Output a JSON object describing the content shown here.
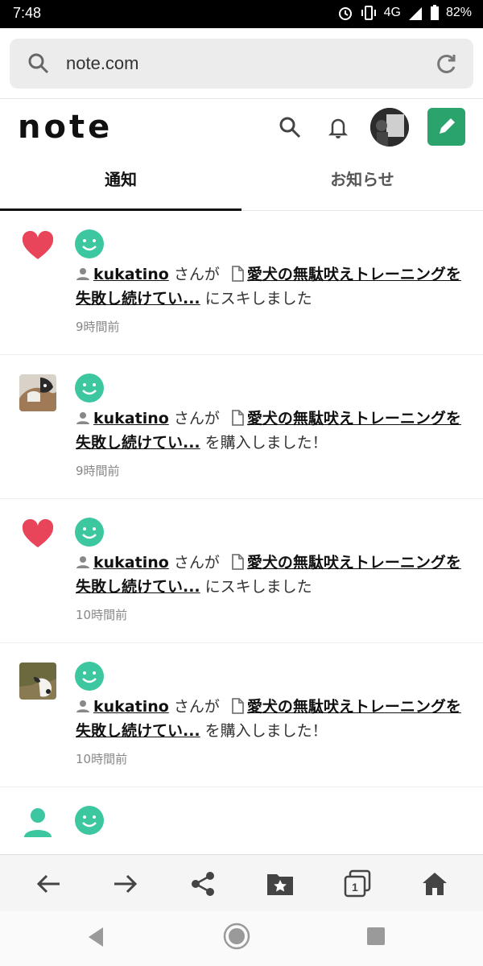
{
  "status": {
    "time": "7:48",
    "network": "4G",
    "battery": "82%"
  },
  "browser": {
    "url": "note.com"
  },
  "header": {
    "logo": "note"
  },
  "tabs": [
    {
      "label": "通知"
    },
    {
      "label": "お知らせ"
    }
  ],
  "notifications": [
    {
      "lead_icon": "heart-icon",
      "username": "kukatino",
      "connector": "さんが",
      "article": "愛犬の無駄吠えトレーニングを失敗し続けてい...",
      "action": "にスキしました",
      "time": "9時間前"
    },
    {
      "lead_icon": "user-thumbnail",
      "username": "kukatino",
      "connector": "さんが",
      "article": "愛犬の無駄吠えトレーニングを失敗し続けてい...",
      "action": "を購入しました！",
      "time": "9時間前"
    },
    {
      "lead_icon": "heart-icon",
      "username": "kukatino",
      "connector": "さんが",
      "article": "愛犬の無駄吠えトレーニングを失敗し続けてい...",
      "action": "にスキしました",
      "time": "10時間前"
    },
    {
      "lead_icon": "user-thumbnail",
      "username": "kukatino",
      "connector": "さんが",
      "article": "愛犬の無駄吠えトレーニングを失敗し続けてい...",
      "action": "を購入しました！",
      "time": "10時間前"
    }
  ],
  "browser_toolbar": {
    "tab_count": "1"
  },
  "colors": {
    "accent": "#2aa46c",
    "heart": "#e8445a",
    "smile": "#3cc7a0"
  }
}
